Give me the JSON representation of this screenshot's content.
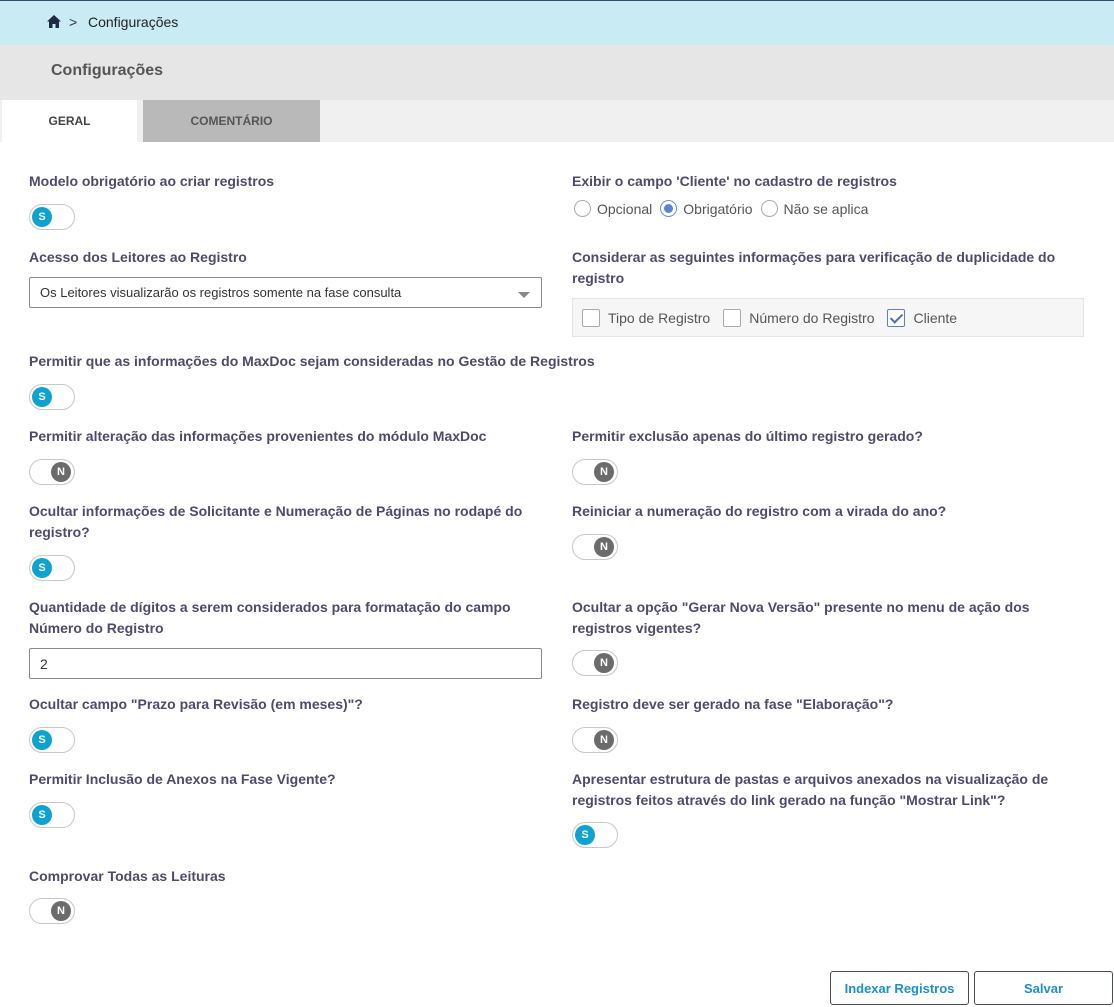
{
  "breadcrumb": {
    "separator": ">",
    "current": "Configurações"
  },
  "page_title": "Configurações",
  "tabs": [
    {
      "label": "GERAL",
      "active": true
    },
    {
      "label": "COMENTÁRIO",
      "active": false
    }
  ],
  "fields": {
    "modelo_obrigatorio": {
      "label": "Modelo obrigatório ao criar registros",
      "value": "S"
    },
    "exibir_cliente": {
      "label": "Exibir o campo 'Cliente' no cadastro de registros",
      "options": [
        "Opcional",
        "Obrigatório",
        "Não se aplica"
      ],
      "selected": "Obrigatório"
    },
    "acesso_leitores": {
      "label": "Acesso dos Leitores ao Registro",
      "value": "Os Leitores visualizarão os registros somente na fase consulta"
    },
    "duplicidade": {
      "label_line1": "Considerar as seguintes informações para verificação de duplicidade do",
      "label_line2": "registro",
      "options": [
        {
          "label": "Tipo de Registro",
          "checked": false
        },
        {
          "label": "Número do Registro",
          "checked": false
        },
        {
          "label": "Cliente",
          "checked": true
        }
      ]
    },
    "maxdoc_gestao": {
      "label": "Permitir que as informações do MaxDoc sejam consideradas no Gestão de Registros",
      "value": "S"
    },
    "alteracao_maxdoc": {
      "label": "Permitir alteração das informações provenientes do módulo MaxDoc",
      "value": "N"
    },
    "exclusao_ultimo": {
      "label": "Permitir exclusão apenas do último registro gerado?",
      "value": "N"
    },
    "ocultar_solicitante": {
      "label_line1": "Ocultar informações de Solicitante e Numeração de Páginas no rodapé do",
      "label_line2": "registro?",
      "value": "S"
    },
    "reiniciar_numeracao": {
      "label": "Reiniciar a numeração do registro com a virada do ano?",
      "value": "N"
    },
    "quantidade_digitos": {
      "label_line1": "Quantidade de dígitos a serem considerados para formatação do campo",
      "label_line2": "Número do Registro",
      "value": "2"
    },
    "ocultar_nova_versao": {
      "label_line1": "Ocultar a opção \"Gerar Nova Versão\" presente no menu de ação dos",
      "label_line2": "registros vigentes?",
      "value": "N"
    },
    "ocultar_prazo": {
      "label": "Ocultar campo \"Prazo para Revisão (em meses)\"?",
      "value": "S"
    },
    "gerado_elaboracao": {
      "label": "Registro deve ser gerado na fase \"Elaboração\"?",
      "value": "N"
    },
    "anexos_vigente": {
      "label": "Permitir Inclusão de Anexos na Fase Vigente?",
      "value": "S"
    },
    "estrutura_pastas": {
      "label_line1": "Apresentar estrutura de pastas e arquivos anexados na visualização de",
      "label_line2": "registros feitos através do link gerado na função \"Mostrar Link\"?",
      "value": "S"
    },
    "comprovar_leituras": {
      "label": "Comprovar Todas as Leituras",
      "value": "N"
    }
  },
  "buttons": {
    "index": "Indexar Registros",
    "save": "Salvar"
  },
  "colors": {
    "toggle_on": "#0ea2d0",
    "toggle_off": "#6b6b6b",
    "topbar": "#c8ebf4",
    "label": "#4f4a6a",
    "button_text": "#1e8fc8"
  }
}
